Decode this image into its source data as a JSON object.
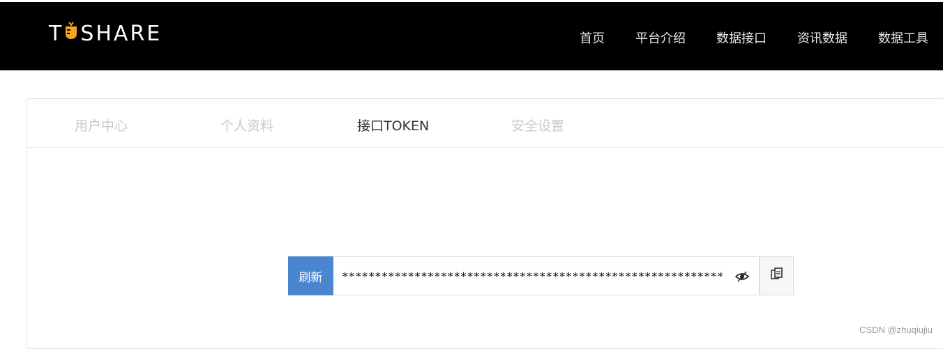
{
  "brand": {
    "logo_prefix": "T",
    "logo_suffix": "SHARE",
    "logo_icon": "carrot-icon",
    "accent": "#f5a623"
  },
  "nav": {
    "items": [
      {
        "label": "首页"
      },
      {
        "label": "平台介绍"
      },
      {
        "label": "数据接口"
      },
      {
        "label": "资讯数据"
      },
      {
        "label": "数据工具"
      }
    ]
  },
  "tabs": [
    {
      "label": "用户中心",
      "active": false
    },
    {
      "label": "个人资料",
      "active": false
    },
    {
      "label": "接口TOKEN",
      "active": true
    },
    {
      "label": "安全设置",
      "active": false
    }
  ],
  "token": {
    "refresh_label": "刷新",
    "value": "*****************************************************************",
    "eye_icon": "eye-slash-icon",
    "copy_icon": "copy-icon",
    "refresh_color": "#4a86cf"
  },
  "watermark": "CSDN @zhuqiujiu"
}
